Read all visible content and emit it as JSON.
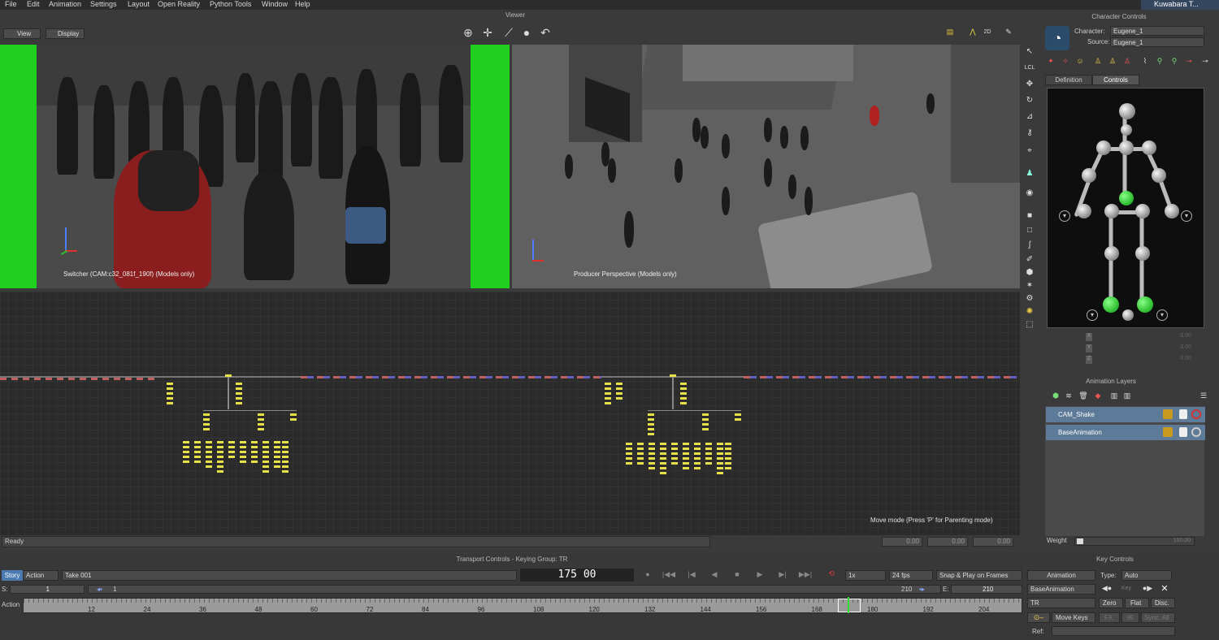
{
  "menu": [
    "File",
    "Edit",
    "Animation",
    "Settings",
    "Layout",
    "Open Reality",
    "Python Tools",
    "Window",
    "Help"
  ],
  "user": "Kuwabara T...",
  "viewer": {
    "title": "Viewer",
    "view_btn": "View",
    "display_btn": "Display",
    "left_label": "Switcher (CAM:c32_081f_190f) (Models only)",
    "right_label": "Producer Perspective (Models only)",
    "mode_text": "2D"
  },
  "graph": {
    "status_hint": "Move mode (Press 'P' for Parenting mode)",
    "status": "Ready",
    "xyz_values": [
      "0.00",
      "0.00",
      "0.00"
    ]
  },
  "character_controls": {
    "title": "Character Controls",
    "character_label": "Character:",
    "character_value": "Eugene_1",
    "source_label": "Source:",
    "source_value": "Eugene_1",
    "tabs": [
      "Definition",
      "Controls"
    ],
    "active_tab": "Controls",
    "field_labels": [
      "X",
      "Y",
      "Z"
    ],
    "field_values": [
      "0.00",
      "0.00",
      "0.00"
    ]
  },
  "animation_layers": {
    "title": "Animation Layers",
    "layers": [
      {
        "name": "CAM_Shake"
      },
      {
        "name": "BaseAnimation"
      }
    ],
    "weight_label": "Weight",
    "weight_value": "100.00"
  },
  "transport": {
    "title": "Transport Controls  -  Keying Group: TR",
    "story_btn": "Story",
    "action_dd": "Action",
    "take": "Take 001",
    "frame_display": "175 00",
    "speed": "1x",
    "fps": "24 fps",
    "snap": "Snap & Play on Frames",
    "start_label": "S:",
    "start_value": "1",
    "range_start": "1",
    "range_end": "210",
    "end_label": "E:",
    "end_value": "210",
    "track_label": "Action",
    "ticks": [
      "12",
      "24",
      "36",
      "48",
      "60",
      "72",
      "84",
      "96",
      "108",
      "120",
      "132",
      "144",
      "156",
      "168",
      "180",
      "192",
      "204"
    ],
    "current_frame": 175
  },
  "key_controls": {
    "title": "Key Controls",
    "animation_btn": "Animation",
    "type_label": "Type:",
    "type_value": "Auto",
    "layer_value": "BaseAnimation",
    "key_label": "Key",
    "group_value": "TR",
    "zero_btn": "Zero",
    "flat_btn": "Flat",
    "disc_btn": "Disc.",
    "move_keys_btn": "Move Keys",
    "fx_btn": "FX",
    "ik_btn": "IK",
    "sync_btn": "Sync. All",
    "ref_label": "Ref:"
  },
  "colors": {
    "accent_blue": "#5d7a98",
    "green_screen": "#1fd01f",
    "graph_nodes": "#e6e04a",
    "effector_green": "#2fbf2f"
  }
}
